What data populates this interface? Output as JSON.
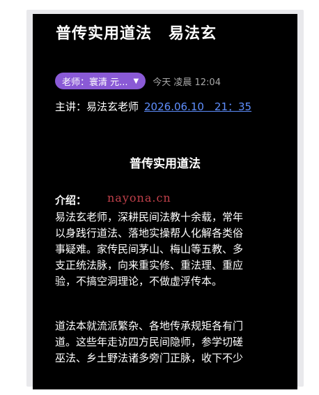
{
  "article": {
    "title_main": "普传实用道法",
    "title_author": "易法玄",
    "teacher_chip": "老师：寰清 元...",
    "teacher_caret": "▼",
    "post_time": "今天 凌晨 12:04",
    "speaker_label": "主讲：易法玄老师",
    "schedule_datetime": "2026.06.10　21：35",
    "section_title": "普传实用道法",
    "intro_label": "介绍：",
    "paragraph1_lines": [
      "易法玄老师，深耕民间法教十余载，常年",
      "以身践行道法、落地实操帮人化解各类俗",
      "事疑难。家传民间茅山、梅山等五教、多",
      "支正统法脉，向来重实修、重法理、重应",
      "验，不搞空洞理论，不做虚浮传本。"
    ],
    "paragraph2_lines": [
      "道法本就流派繁杂、各地传承规矩各有门",
      "道。这些年走访四方民间隐师，参学切磋",
      "巫法、乡土野法诸多旁门正脉，收下不少"
    ]
  },
  "watermark": "nayona.cn",
  "colors": {
    "chip_purple": "#8a5ad6",
    "link_blue": "#5f8fff",
    "watermark_red": "#c0404a",
    "screen_bg": "#000000"
  }
}
